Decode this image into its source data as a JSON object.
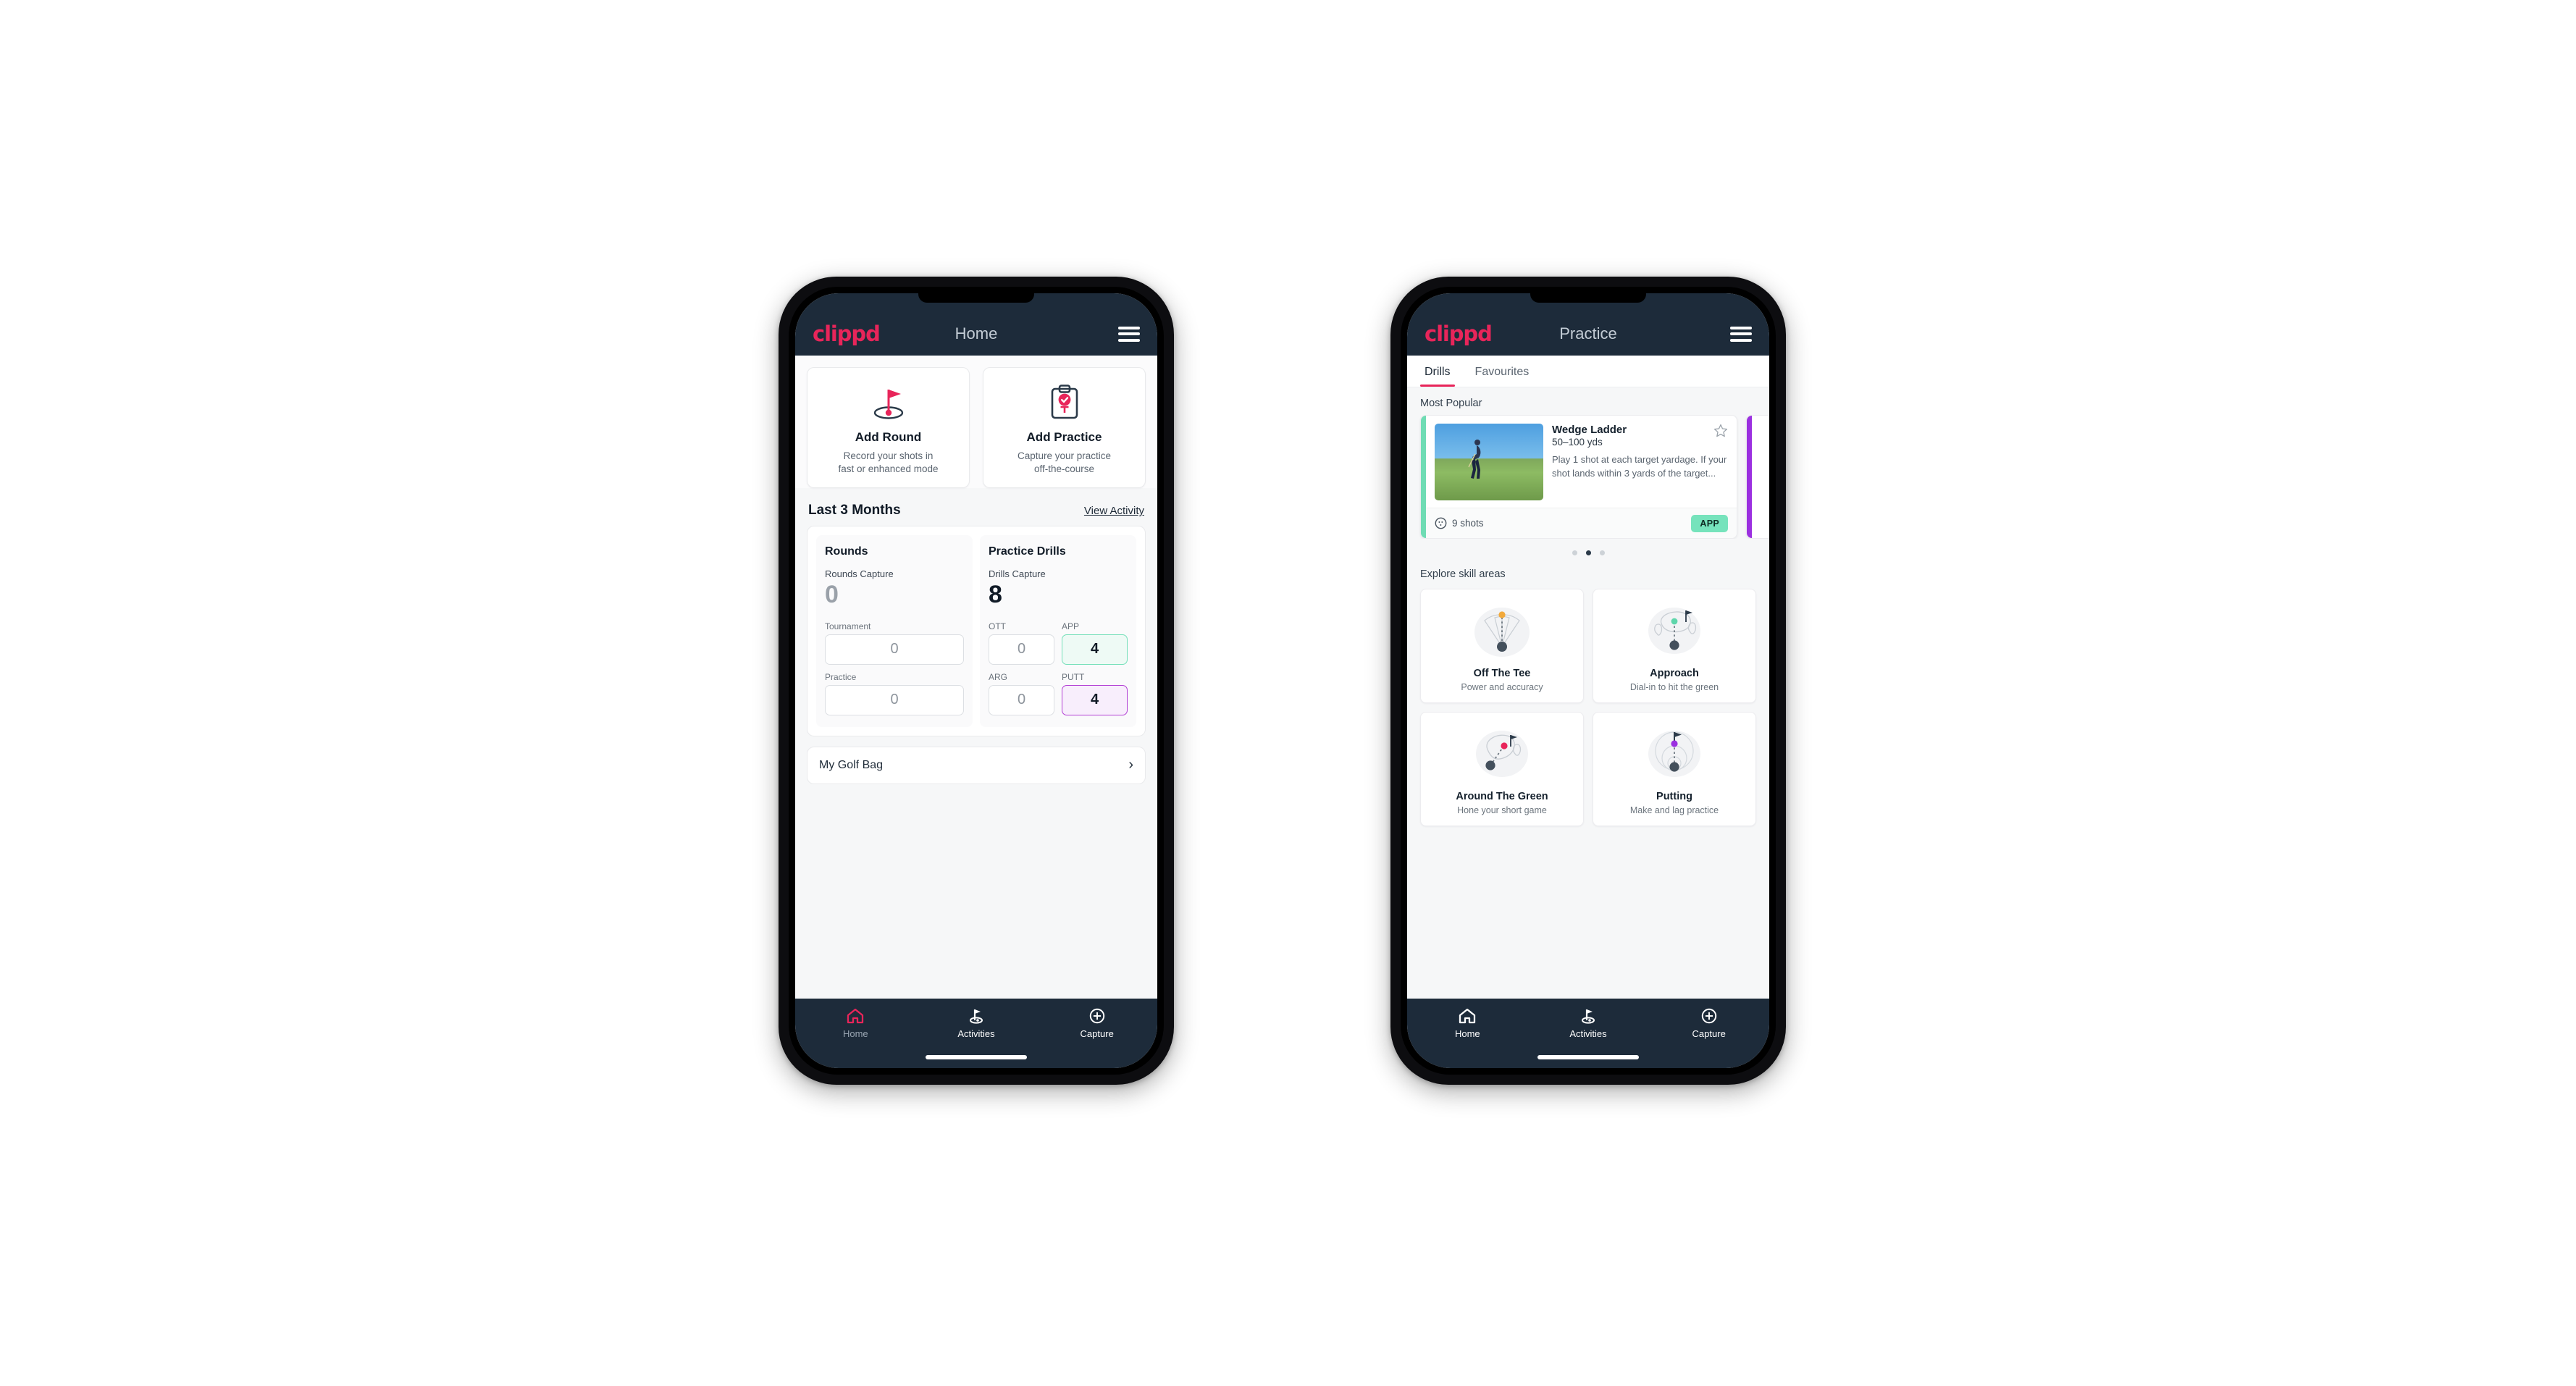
{
  "brand": {
    "logo_text": "clippd",
    "accent": "#e8255a",
    "dark": "#1d2b3a"
  },
  "phone_home": {
    "appbar": {
      "title": "Home",
      "menu_icon": "hamburger-icon"
    },
    "quick_actions": [
      {
        "icon": "golf-flag-hole-icon",
        "title": "Add Round",
        "desc_line1": "Record your shots in",
        "desc_line2": "fast or enhanced mode"
      },
      {
        "icon": "clipboard-check-tee-icon",
        "title": "Add Practice",
        "desc_line1": "Capture your practice",
        "desc_line2": "off-the-course"
      }
    ],
    "section": {
      "title": "Last 3 Months",
      "link": "View Activity"
    },
    "rounds": {
      "heading": "Rounds",
      "capture_label": "Rounds Capture",
      "capture_value": "0",
      "fields": [
        {
          "label": "Tournament",
          "value": "0",
          "state": "empty"
        },
        {
          "label": "Practice",
          "value": "0",
          "state": "empty"
        }
      ]
    },
    "drills": {
      "heading": "Practice Drills",
      "capture_label": "Drills Capture",
      "capture_value": "8",
      "fields": [
        {
          "label": "OTT",
          "value": "0",
          "state": "empty"
        },
        {
          "label": "APP",
          "value": "4",
          "state": "app",
          "color": "#74e0b9"
        },
        {
          "label": "ARG",
          "value": "0",
          "state": "empty"
        },
        {
          "label": "PUTT",
          "value": "4",
          "state": "putt",
          "color": "#b23fd4"
        }
      ]
    },
    "golf_bag": {
      "label": "My Golf Bag",
      "chevron": "chevron-right-icon"
    },
    "bottom_nav": [
      {
        "label": "Home",
        "icon": "home-icon",
        "active": true
      },
      {
        "label": "Activities",
        "icon": "golf-flag-icon",
        "active": false
      },
      {
        "label": "Capture",
        "icon": "plus-circle-icon",
        "active": false
      }
    ]
  },
  "phone_practice": {
    "appbar": {
      "title": "Practice",
      "menu_icon": "hamburger-icon"
    },
    "tabs": [
      {
        "label": "Drills",
        "active": true
      },
      {
        "label": "Favourites",
        "active": false
      }
    ],
    "most_popular_label": "Most Popular",
    "drill_card": {
      "accent_color": "#6fdcb4",
      "name": "Wedge Ladder",
      "yardage": "50–100 yds",
      "description": "Play 1 shot at each target yardage. If your shot lands within 3 yards of the target...",
      "shots": "9 shots",
      "shots_icon": "golf-ball-icon",
      "badge": "APP",
      "badge_color": "#76e3bc",
      "favourite_icon": "star-outline-icon"
    },
    "next_card_accent": "#9b30e0",
    "carousel_dots": {
      "count": 3,
      "active_index": 1
    },
    "skill_section_label": "Explore skill areas",
    "skill_areas": [
      {
        "icon": "tee-fan-icon",
        "name": "Off The Tee",
        "desc": "Power and accuracy",
        "marker": "#f2a93b"
      },
      {
        "icon": "green-target-icon",
        "name": "Approach",
        "desc": "Dial-in to hit the green",
        "marker": "#5fd6ab"
      },
      {
        "icon": "chip-green-icon",
        "name": "Around The Green",
        "desc": "Hone your short game",
        "marker": "#e8255a"
      },
      {
        "icon": "putt-rings-icon",
        "name": "Putting",
        "desc": "Make and lag practice",
        "marker": "#9b30e0"
      }
    ],
    "bottom_nav": [
      {
        "label": "Home",
        "icon": "home-icon",
        "active": false
      },
      {
        "label": "Activities",
        "icon": "golf-flag-icon",
        "active": false
      },
      {
        "label": "Capture",
        "icon": "plus-circle-icon",
        "active": false
      }
    ]
  }
}
